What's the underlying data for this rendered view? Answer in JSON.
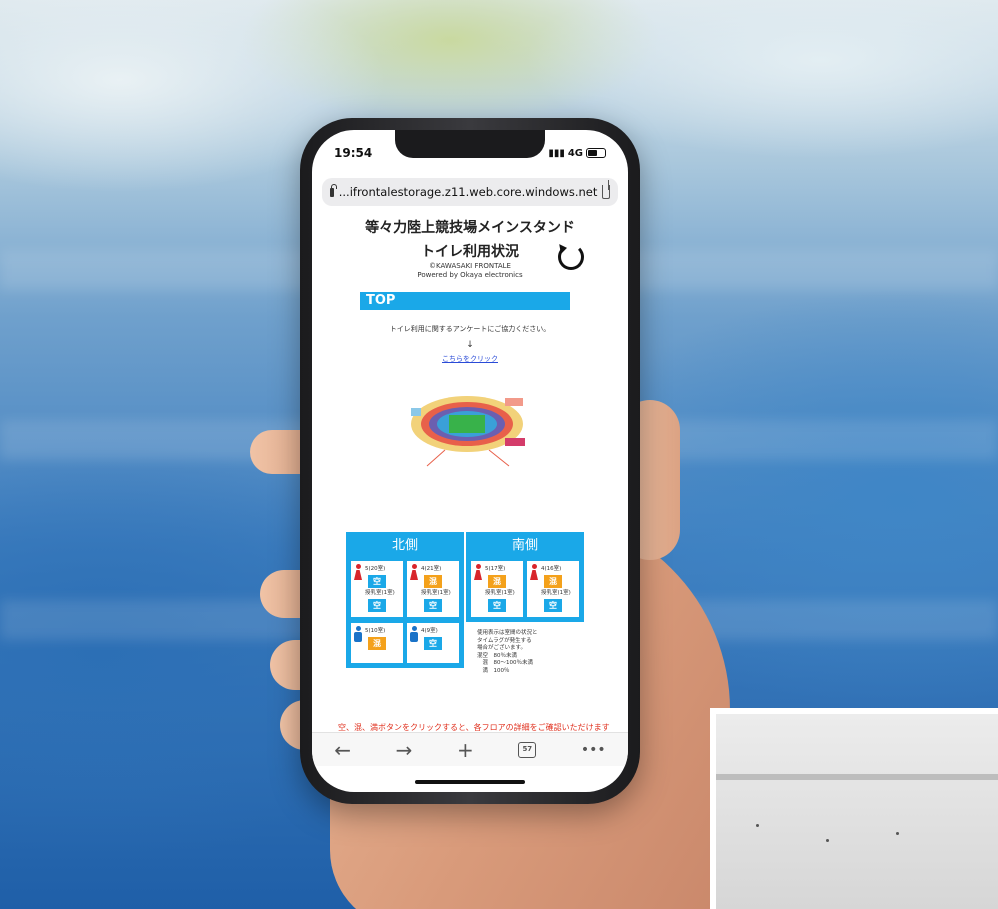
{
  "status_bar": {
    "time": "19:54",
    "signal": "4G"
  },
  "browser": {
    "url": "...ifrontalestorage.z11.web.core.windows.net",
    "tab_count": "57"
  },
  "page": {
    "title_line1": "等々力陸上競技場メインスタンド",
    "title_line2": "トイレ利用状況",
    "copyright": "©KAWASAKI FRONTALE",
    "powered_by": "Powered by Okaya electronics",
    "section_label": "TOP",
    "survey_text": "トイレ利用に関するアンケートにご協力ください。",
    "arrow": "↓",
    "survey_link": "こちらをクリック"
  },
  "sides": [
    {
      "name": "北側",
      "cells": [
        {
          "gender": "female",
          "floor": "5(20室)",
          "status": "空",
          "sub_label": "授乳室(1室)",
          "sub_status": "空"
        },
        {
          "gender": "female",
          "floor": "4(21室)",
          "status": "混",
          "sub_label": "授乳室(1室)",
          "sub_status": "空"
        },
        {
          "gender": "male",
          "floor": "5(10室)",
          "status": "混"
        },
        {
          "gender": "male",
          "floor": "4(9室)",
          "status": "空"
        }
      ]
    },
    {
      "name": "南側",
      "cells": [
        {
          "gender": "female",
          "floor": "5(17室)",
          "status": "混",
          "sub_label": "授乳室(1室)",
          "sub_status": "空"
        },
        {
          "gender": "female",
          "floor": "4(16室)",
          "status": "混",
          "sub_label": "授乳室(1室)",
          "sub_status": "空"
        }
      ]
    }
  ],
  "legend": {
    "line1": "使用表示は室間の状況と",
    "line2": "タイムラグが発生する",
    "line3": "場合がございます。",
    "line4": "混空　80％未満",
    "line5": "　混　80〜100％未満",
    "line6": "　満　100％"
  },
  "notice": "空、混、満ボタンをクリックすると、各フロアの詳細をご確認いただけます",
  "nav": {
    "back": "←",
    "forward": "→",
    "new_tab": "+",
    "more": "•••"
  },
  "colors": {
    "accent": "#1aa8e8",
    "busy": "#f4a11b",
    "notice": "#e0301e"
  }
}
